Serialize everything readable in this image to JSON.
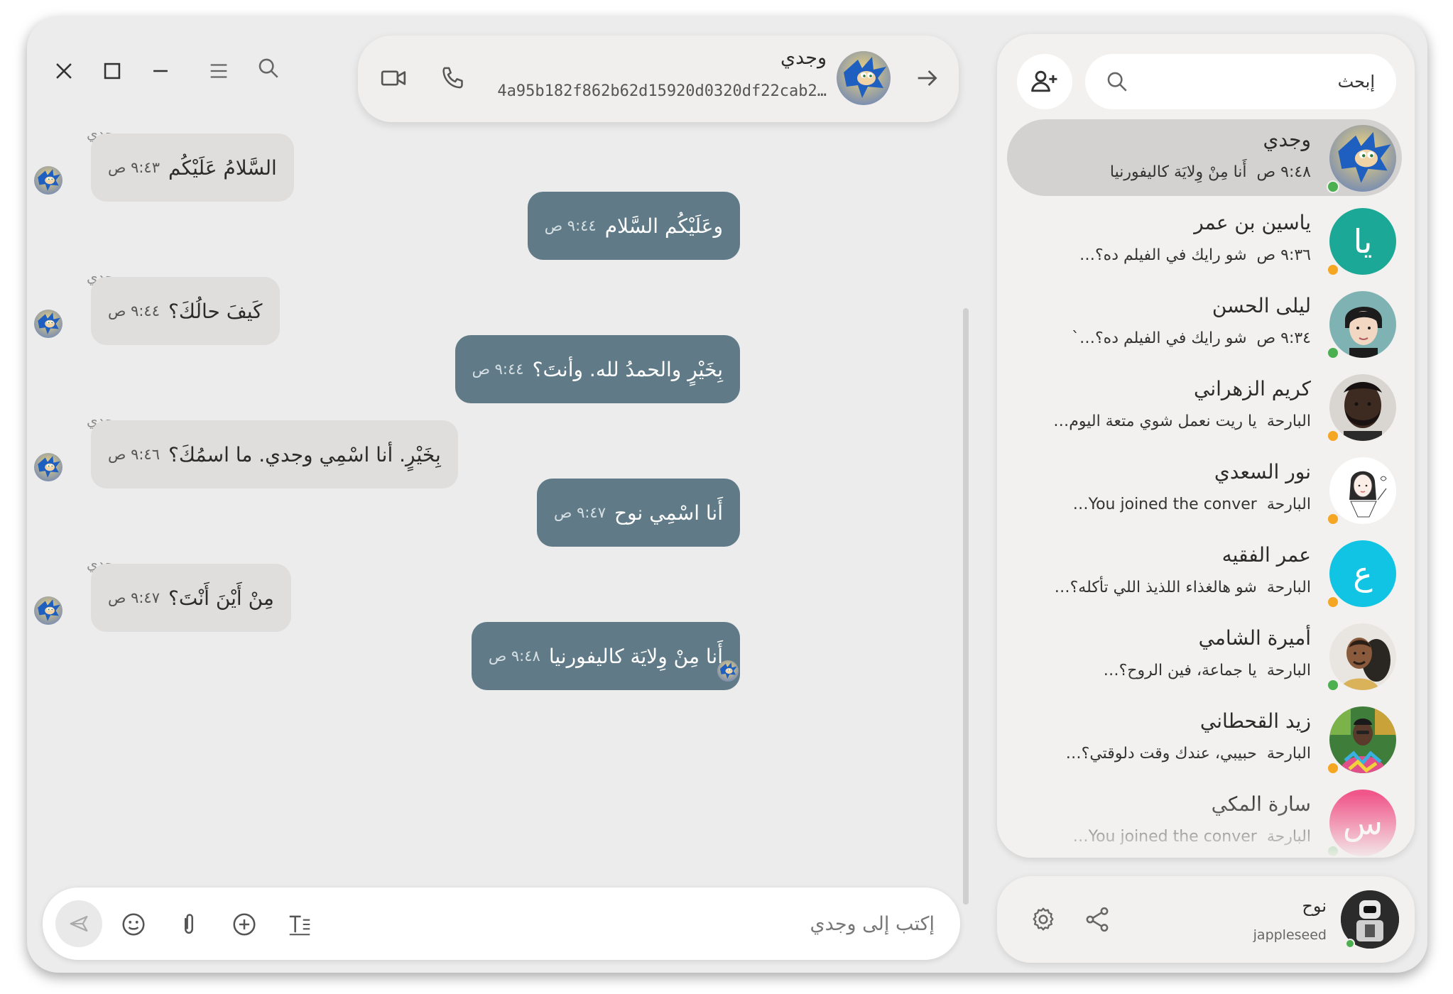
{
  "window_controls": {
    "close_icon": "close-icon",
    "maximize_icon": "maximize-icon",
    "minimize_icon": "minimize-icon",
    "menu_icon": "menu-icon",
    "search_icon": "search-icon"
  },
  "chat_header": {
    "name": "وجدي",
    "id": "4a95b182f862b62d15920d0320df22cab2…",
    "icons": [
      "video-icon",
      "phone-icon",
      "arrow-forward-icon"
    ]
  },
  "messages": [
    {
      "direction": "in",
      "sender": "وجدي",
      "text": "السَّلامُ عَلَيْكُم",
      "time": "٩:٤٣ ص"
    },
    {
      "direction": "out",
      "text": "وعَلَيْكُم السَّلام",
      "time": "٩:٤٤ ص"
    },
    {
      "direction": "in",
      "sender": "وجدي",
      "text": "كَيفَ حالُكَ؟",
      "time": "٩:٤٤ ص"
    },
    {
      "direction": "out",
      "text": "بِخَيْرٍ والحمدُ لله. وأنتَ؟",
      "time": "٩:٤٤ ص"
    },
    {
      "direction": "in",
      "sender": "وجدي",
      "text": "بِخَيْرٍ. أنا اسْمِي وجدي. ما اسمُكَ؟",
      "time": "٩:٤٦ ص"
    },
    {
      "direction": "out",
      "text": "أَنا اسْمِي نوح",
      "time": "٩:٤٧ ص"
    },
    {
      "direction": "in",
      "sender": "وجدي",
      "text": "مِنْ أَيْنَ أَنْتَ؟",
      "time": "٩:٤٧ ص"
    },
    {
      "direction": "out",
      "text": "أَنا مِنْ وِلايَة كاليفورنيا",
      "time": "٩:٤٨ ص"
    }
  ],
  "composer": {
    "placeholder": "إكتب إلى وجدي",
    "icons": [
      "send-icon",
      "emoji-icon",
      "attach-icon",
      "add-icon",
      "text-format-icon"
    ]
  },
  "sidebar": {
    "search_placeholder": "إبحث",
    "add_contact_icon": "add-contact-icon",
    "contacts": [
      {
        "name": "وجدي",
        "time": "٩:٤٨ ص",
        "preview": "أَنا مِنْ وِلايَة كاليفورنيا",
        "avatar": "sonic",
        "status": "online",
        "active": true
      },
      {
        "name": "ياسين بن عمر",
        "time": "٩:٣٦ ص",
        "preview": "شو رايك في الفيلم ده؟…",
        "avatar": "initials",
        "initials": "يا",
        "color": "#1ba896",
        "status": "away"
      },
      {
        "name": "ليلى الحسن",
        "time": "٩:٣٤ ص",
        "preview": "شو رايك في الفيلم ده؟…`",
        "avatar": "cartoon-woman",
        "status": "online"
      },
      {
        "name": "كريم الزهراني",
        "time": "البارحة",
        "preview": "يا ريت نعمل شوي متعة اليوم…",
        "avatar": "man-beard",
        "status": "away"
      },
      {
        "name": "نور السعدي",
        "time": "البارحة",
        "preview": "You joined the conver…",
        "avatar": "sketch-girl",
        "status": "away"
      },
      {
        "name": "عمر الفقيه",
        "time": "البارحة",
        "preview": "شو هالغذاء اللذيذ اللي تأكله؟…",
        "avatar": "initials",
        "initials": "ع",
        "color": "#12c4e4",
        "status": "away"
      },
      {
        "name": "أميرة الشامي",
        "time": "البارحة",
        "preview": "يا جماعة، فين الروح؟…",
        "avatar": "man-portrait",
        "status": "online"
      },
      {
        "name": "زيد القحطاني",
        "time": "البارحة",
        "preview": "حبيبي، عندك وقت دلوقتي؟…",
        "avatar": "colorful",
        "status": "away"
      },
      {
        "name": "سارة المكي",
        "time": "البارحة",
        "preview": "You joined the conver…",
        "avatar": "initials",
        "initials": "س",
        "color": "#f0568a",
        "status": "online"
      }
    ]
  },
  "profile": {
    "name": "نوح",
    "username": "jappleseed",
    "icons": [
      "settings-icon",
      "share-icon"
    ]
  },
  "colors": {
    "outgoing_bubble": "#607b87",
    "incoming_bubble": "#e0dedc",
    "online": "#4caf50",
    "away": "#f5a623"
  }
}
